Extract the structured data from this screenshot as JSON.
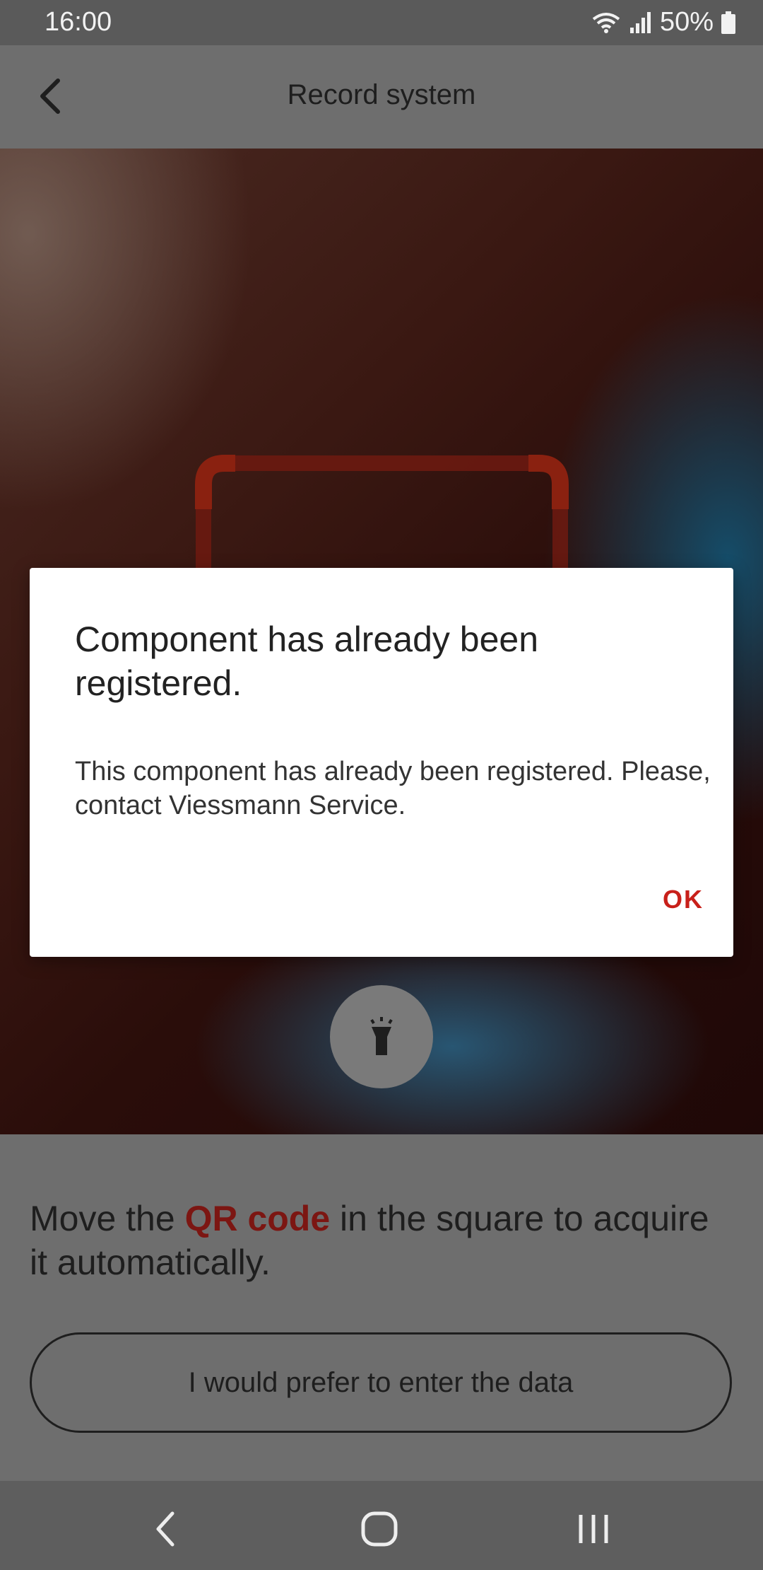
{
  "status_bar": {
    "time": "16:00",
    "battery": "50%",
    "icons": [
      "wifi-icon",
      "signal-icon",
      "battery-icon"
    ]
  },
  "app_bar": {
    "title": "Record system",
    "back_icon": "back-arrow-icon"
  },
  "camera": {
    "torch_icon": "flashlight-icon"
  },
  "instructions": {
    "prefix": "Move the ",
    "highlight": "QR code",
    "suffix": " in the square to acquire it automatically."
  },
  "manual_entry_button": "I would prefer to enter the data",
  "dialog": {
    "title": "Component has already been registered.",
    "message": "This component has already been registered. Please, contact Viessmann Service.",
    "ok_label": "OK"
  },
  "nav_bar": {
    "items": [
      "back-nav-icon",
      "home-nav-icon",
      "recents-nav-icon"
    ]
  },
  "colors": {
    "accent": "#c8201a",
    "highlight_dimmed": "#7c1612",
    "scrim": "#6e6e6e"
  }
}
